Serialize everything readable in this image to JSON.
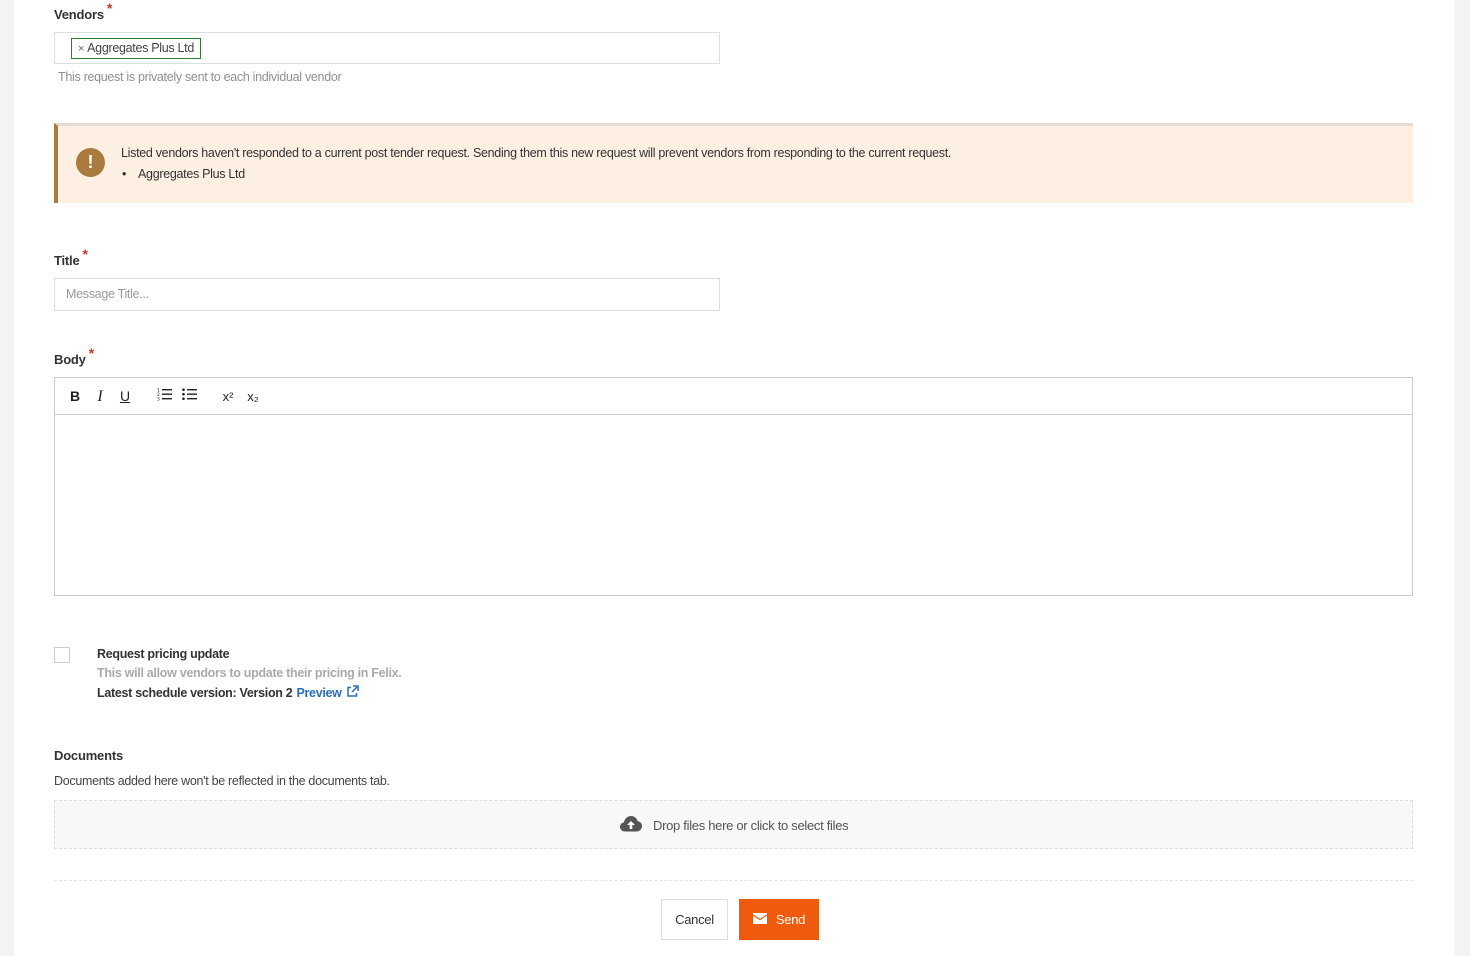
{
  "vendors": {
    "label": "Vendors",
    "required_mark": "*",
    "tags": [
      {
        "remove": "×",
        "name": "Aggregates Plus Ltd"
      }
    ],
    "hint": "This request is privately sent to each individual vendor"
  },
  "alert": {
    "icon": "!",
    "message": "Listed vendors haven't responded to a current post tender request. Sending them this new request will prevent vendors from responding to the current request.",
    "vendors": [
      "Aggregates Plus Ltd"
    ],
    "color": "#a97b3e",
    "background": "#fdf0e3"
  },
  "title_field": {
    "label": "Title",
    "required_mark": "*",
    "placeholder": "Message Title..."
  },
  "body_field": {
    "label": "Body",
    "required_mark": "*",
    "toolbar": {
      "bold": "B",
      "italic": "I",
      "underline": "U",
      "ordered_list_icon": "ordered-list-icon",
      "bullet_list_icon": "bullet-list-icon",
      "superscript": "x²",
      "subscript": "x₂"
    }
  },
  "pricing": {
    "label": "Request pricing update",
    "description": "This will allow vendors to update their pricing in Felix.",
    "schedule_text": "Latest schedule version: Version 2",
    "preview_link": "Preview",
    "checked": false
  },
  "documents": {
    "label": "Documents",
    "note": "Documents added here won't be reflected in the documents tab.",
    "dropzone_text": "Drop files here or click to select files"
  },
  "actions": {
    "cancel": "Cancel",
    "send": "Send",
    "send_color": "#f05a0c"
  }
}
